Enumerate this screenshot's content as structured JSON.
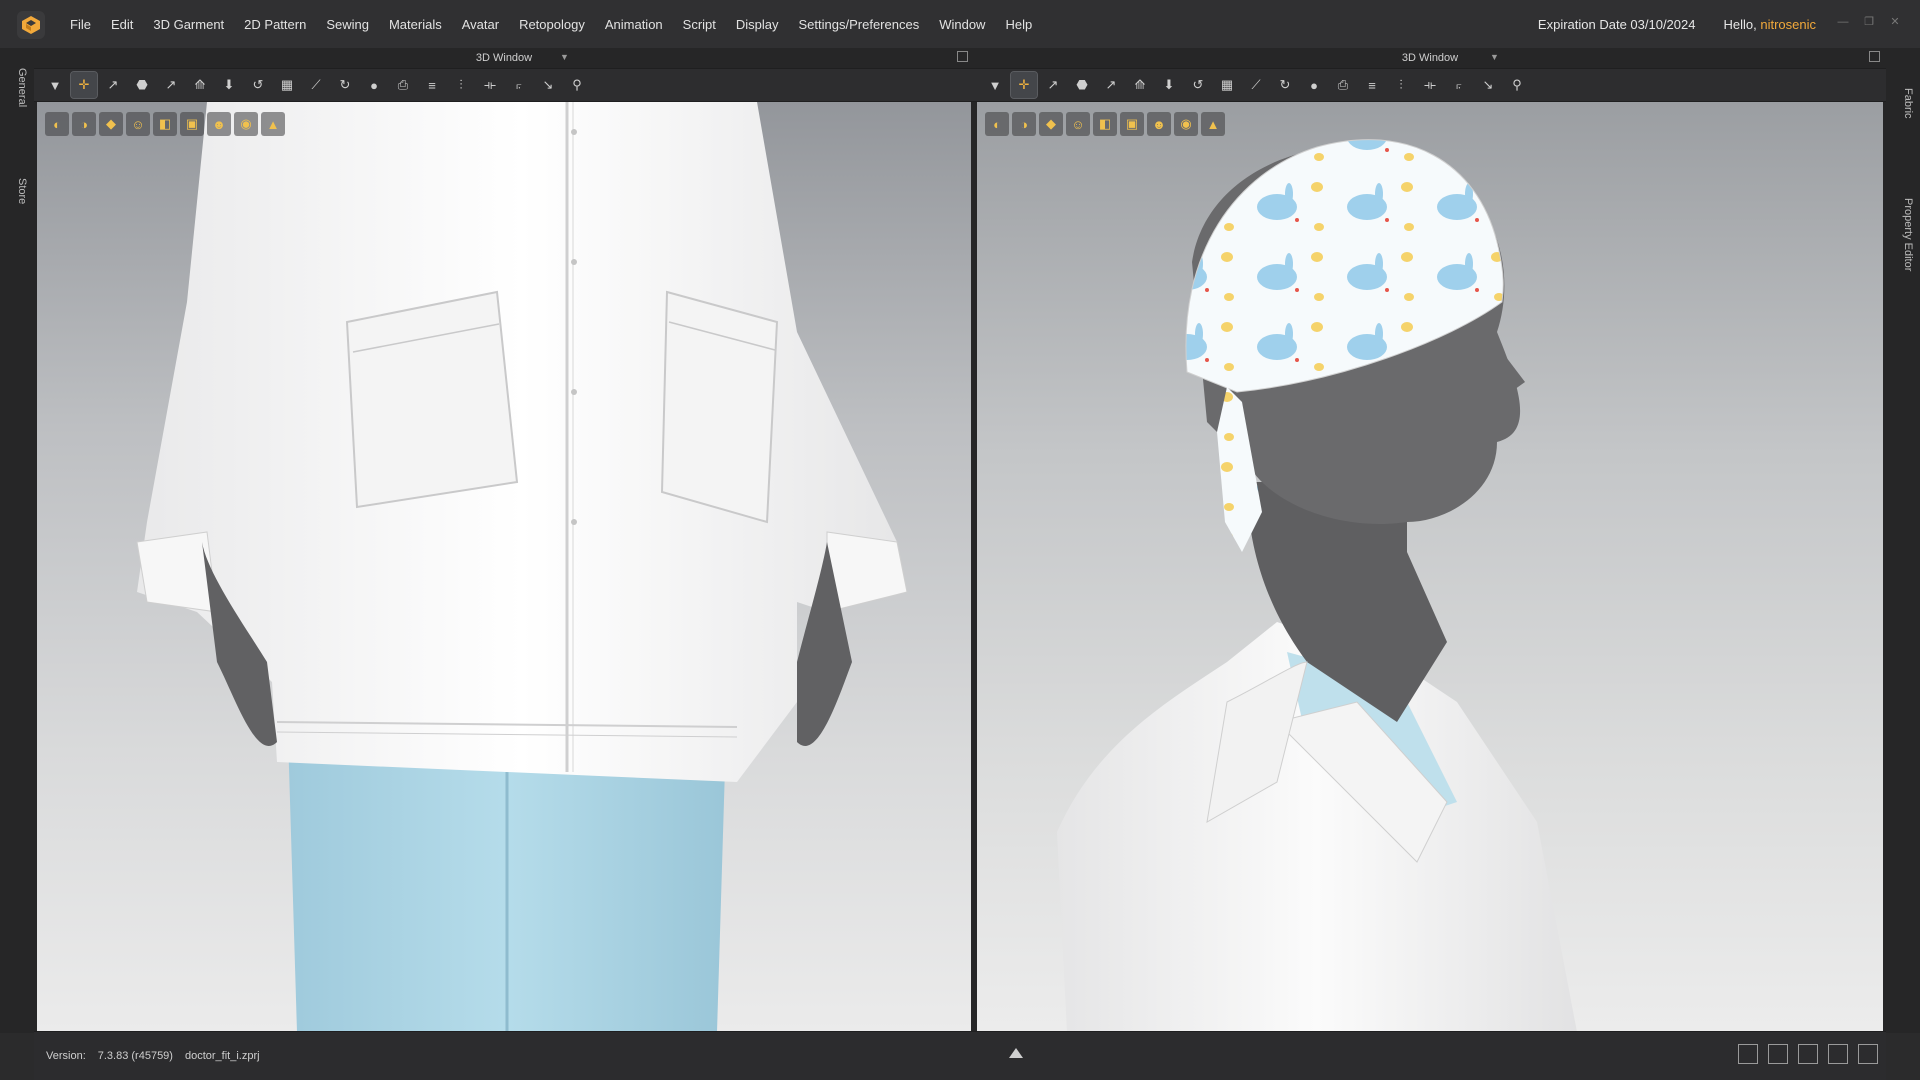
{
  "menubar": {
    "items": [
      "File",
      "Edit",
      "3D Garment",
      "2D Pattern",
      "Sewing",
      "Materials",
      "Avatar",
      "Retopology",
      "Animation",
      "Script",
      "Display",
      "Settings/Preferences",
      "Window",
      "Help"
    ],
    "expiration": "Expiration Date 03/10/2024",
    "hello": "Hello,",
    "username": "nitrosenic"
  },
  "left_rail": {
    "tabs": [
      "General",
      "Store"
    ]
  },
  "right_rail": {
    "tabs": [
      "Fabric",
      "Property Editor"
    ]
  },
  "panels": [
    {
      "title": "3D Window"
    },
    {
      "title": "3D Window"
    }
  ],
  "toolbar": {
    "icons": [
      "select-mesh-icon",
      "move-icon",
      "transform-pattern-icon",
      "select-garment-icon",
      "edit-curvature-icon",
      "fold-arrange-icon",
      "tack-icon",
      "add-tack-icon",
      "rotate-tack-icon",
      "grid-icon",
      "pin-icon",
      "point-pin-icon",
      "pin-box-icon",
      "strap-icon",
      "fold-icon",
      "button-icon",
      "measure-icon",
      "attach-icon",
      "mannequin-icon"
    ]
  },
  "viewport_tools": {
    "icons": [
      "show-avatar-icon",
      "show-garment-icon",
      "show-texture-icon",
      "show-skeleton-icon",
      "show-shadow-icon",
      "render-icon",
      "skin-icon",
      "fabric-icon",
      "light-icon"
    ]
  },
  "status": {
    "version_label": "Version:",
    "version": "7.3.83 (r45759)",
    "file": "doctor_fit_i.zprj"
  },
  "colors": {
    "accent": "#f2a93b",
    "scrub_blue": "#a9d3e4",
    "skin_gray": "#6d6d6f",
    "coat_white": "#f4f4f4"
  }
}
